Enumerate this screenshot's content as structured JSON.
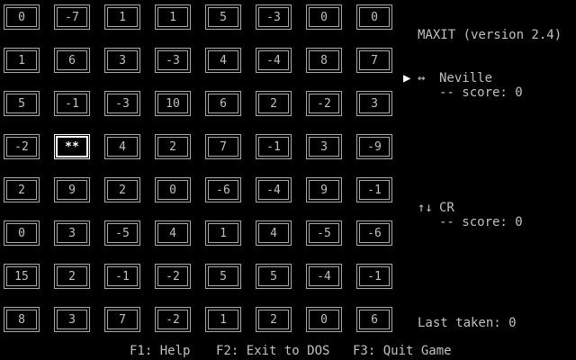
{
  "board": {
    "rows": [
      [
        "0",
        "-7",
        "1",
        "1",
        "5",
        "-3",
        "0",
        "0"
      ],
      [
        "1",
        "6",
        "3",
        "-3",
        "4",
        "-4",
        "8",
        "7"
      ],
      [
        "5",
        "-1",
        "-3",
        "10",
        "6",
        "2",
        "-2",
        "3"
      ],
      [
        "-2",
        "**",
        "4",
        "2",
        "7",
        "-1",
        "3",
        "-9"
      ],
      [
        "2",
        "9",
        "2",
        "0",
        "-6",
        "-4",
        "9",
        "-1"
      ],
      [
        "0",
        "3",
        "-5",
        "4",
        "1",
        "4",
        "-5",
        "-6"
      ],
      [
        "15",
        "2",
        "-1",
        "-2",
        "5",
        "5",
        "-4",
        "-1"
      ],
      [
        "8",
        "3",
        "7",
        "-2",
        "1",
        "2",
        "0",
        "6"
      ]
    ],
    "cursor": {
      "row": 3,
      "col": 1
    }
  },
  "sidebar": {
    "title": "MAXIT (version 2.4)",
    "player1": {
      "pointer": "▶",
      "arrow": "↔",
      "name": "Neville",
      "score_label": "-- score: 0"
    },
    "player2": {
      "arrow": "↑↓",
      "name": "CR",
      "score_label": "-- score: 0"
    },
    "last_taken": "Last taken: 0"
  },
  "footer": {
    "f1": "F1: Help",
    "f2": "F2: Exit to DOS",
    "f3": "F3: Quit Game"
  },
  "colors": {
    "background": "#000000",
    "text": "#c0c0c0",
    "highlight": "#ffffff"
  }
}
